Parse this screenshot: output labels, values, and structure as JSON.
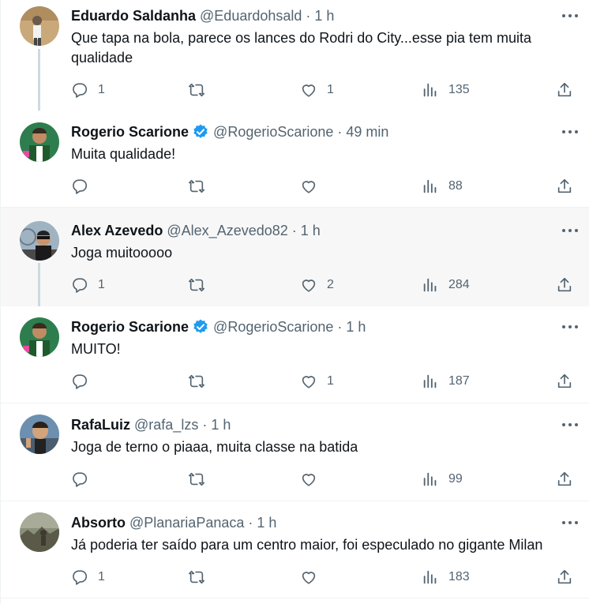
{
  "tweets": [
    {
      "name": "Eduardo Saldanha",
      "handle": "@Eduardohsald",
      "time": "1 h",
      "text": "Que tapa na bola, parece os lances do Rodri do City...esse pia tem muita qualidade",
      "replies": "1",
      "retweets": "",
      "likes": "1",
      "views": "135",
      "verified": false,
      "highlight": false
    },
    {
      "name": "Rogerio Scarione",
      "handle": "@RogerioScarione",
      "time": "49 min",
      "text": "Muita qualidade!",
      "replies": "",
      "retweets": "",
      "likes": "",
      "views": "88",
      "verified": true,
      "highlight": false
    },
    {
      "name": "Alex Azevedo",
      "handle": "@Alex_Azevedo82",
      "time": "1 h",
      "text": "Joga muitooooo",
      "replies": "1",
      "retweets": "",
      "likes": "2",
      "views": "284",
      "verified": false,
      "highlight": true
    },
    {
      "name": "Rogerio Scarione",
      "handle": "@RogerioScarione",
      "time": "1 h",
      "text": "MUITO!",
      "replies": "",
      "retweets": "",
      "likes": "1",
      "views": "187",
      "verified": true,
      "highlight": false
    },
    {
      "name": "RafaLuiz",
      "handle": "@rafa_lzs",
      "time": "1 h",
      "text": "Joga de terno o piaaa, muita classe na batida",
      "replies": "",
      "retweets": "",
      "likes": "",
      "views": "99",
      "verified": false,
      "highlight": false
    },
    {
      "name": "Absorto",
      "handle": "@PlanariaPanaca",
      "time": "1 h",
      "text": "Já poderia ter saído para um centro maior, foi especulado no gigante Milan",
      "replies": "1",
      "retweets": "",
      "likes": "",
      "views": "183",
      "verified": false,
      "highlight": false
    }
  ],
  "icons": {
    "reply": "reply-icon",
    "retweet": "retweet-icon",
    "like": "heart-icon",
    "views": "views-icon",
    "share": "share-icon",
    "more": "more-icon",
    "verified": "verified-badge-icon"
  },
  "colors": {
    "text": "#0f1419",
    "secondary": "#536471",
    "verified": "#1d9bf0",
    "thread_line": "#cfd9de",
    "highlight_bg": "#f7f7f7",
    "divider": "#eff3f4"
  }
}
